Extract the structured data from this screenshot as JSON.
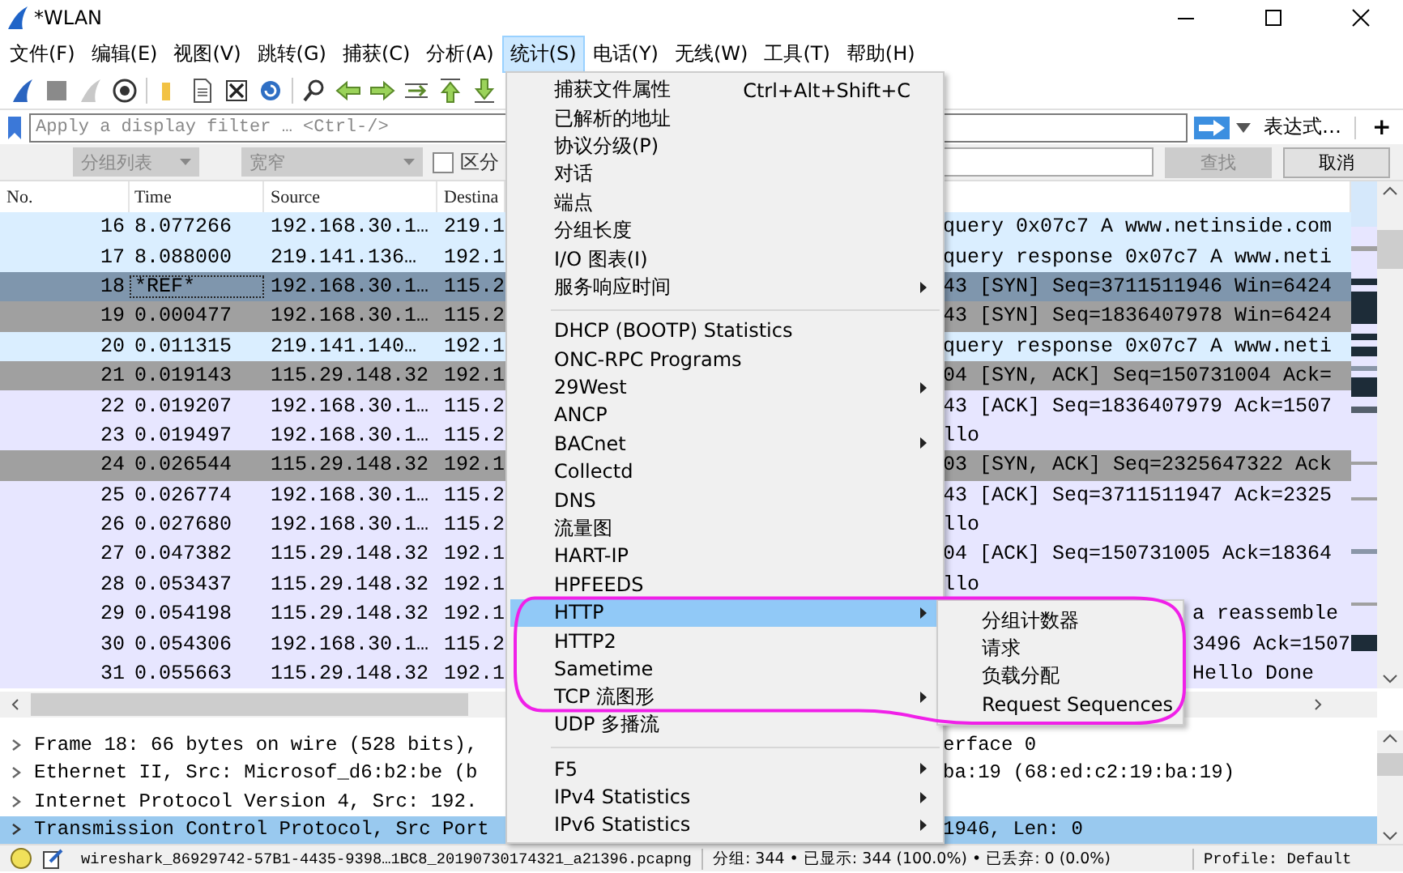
{
  "window": {
    "title": "*WLAN"
  },
  "menubar": [
    {
      "label": "文件(F)",
      "selected": false
    },
    {
      "label": "编辑(E)",
      "selected": false
    },
    {
      "label": "视图(V)",
      "selected": false
    },
    {
      "label": "跳转(G)",
      "selected": false
    },
    {
      "label": "捕获(C)",
      "selected": false
    },
    {
      "label": "分析(A)",
      "selected": false
    },
    {
      "label": "统计(S)",
      "selected": true
    },
    {
      "label": "电话(Y)",
      "selected": false
    },
    {
      "label": "无线(W)",
      "selected": false
    },
    {
      "label": "工具(T)",
      "selected": false
    },
    {
      "label": "帮助(H)",
      "selected": false
    }
  ],
  "display_filter": {
    "placeholder": "Apply a display filter … <Ctrl-/>",
    "expression_button": "表达式…",
    "add_button": "+"
  },
  "find_bar": {
    "scope": {
      "value": "分组列表",
      "disabled": true
    },
    "charset": {
      "value": "宽窄",
      "disabled": true
    },
    "case_checkbox": {
      "label": "区分",
      "checked": false
    },
    "find_button": {
      "label": "查找",
      "disabled": true
    },
    "cancel_button": {
      "label": "取消",
      "disabled": false
    }
  },
  "packet_list": {
    "columns": [
      "No.",
      "Time",
      "Source",
      "Destina"
    ],
    "rows": [
      {
        "no": "16",
        "time": "8.077266",
        "source": "192.168.30.1…",
        "destination": "219.1",
        "info": "query 0x07c7 A www.netinside.com",
        "color": "#daeeff",
        "selected": false,
        "info_covered": false
      },
      {
        "no": "17",
        "time": "8.088000",
        "source": "219.141.136…",
        "destination": "192.1",
        "info": "query response 0x07c7 A www.neti",
        "color": "#daeeff",
        "selected": false,
        "info_covered": false
      },
      {
        "no": "18",
        "time": "*REF*",
        "source": "192.168.30.1…",
        "destination": "115.2",
        "info": "43 [SYN] Seq=3711511946 Win=6424",
        "selected": true,
        "info_covered": false
      },
      {
        "no": "19",
        "time": "0.000477",
        "source": "192.168.30.1…",
        "destination": "115.2",
        "info": "43 [SYN] Seq=1836407978 Win=6424",
        "color": "#a0a0a0",
        "selected": false,
        "info_covered": false
      },
      {
        "no": "20",
        "time": "0.011315",
        "source": "219.141.140…",
        "destination": "192.1",
        "info": "query response 0x07c7 A www.neti",
        "color": "#daeeff",
        "selected": false,
        "info_covered": false
      },
      {
        "no": "21",
        "time": "0.019143",
        "source": "115.29.148.32",
        "destination": "192.1",
        "info": "04 [SYN, ACK] Seq=150731004 Ack=",
        "color": "#a0a0a0",
        "selected": false,
        "info_covered": false
      },
      {
        "no": "22",
        "time": "0.019207",
        "source": "192.168.30.1…",
        "destination": "115.2",
        "info": "43 [ACK] Seq=1836407979 Ack=1507",
        "color": "#e7e6ff",
        "selected": false,
        "info_covered": false
      },
      {
        "no": "23",
        "time": "0.019497",
        "source": "192.168.30.1…",
        "destination": "115.2",
        "info": "llo",
        "color": "#e7e6ff",
        "selected": false,
        "info_covered": false
      },
      {
        "no": "24",
        "time": "0.026544",
        "source": "115.29.148.32",
        "destination": "192.1",
        "info": "03 [SYN, ACK] Seq=2325647322 Ack",
        "color": "#a0a0a0",
        "selected": false,
        "info_covered": false
      },
      {
        "no": "25",
        "time": "0.026774",
        "source": "192.168.30.1…",
        "destination": "115.2",
        "info": "43 [ACK] Seq=3711511947 Ack=2325",
        "color": "#e7e6ff",
        "selected": false,
        "info_covered": false
      },
      {
        "no": "26",
        "time": "0.027680",
        "source": "192.168.30.1…",
        "destination": "115.2",
        "info": "llo",
        "color": "#e7e6ff",
        "selected": false,
        "info_covered": false
      },
      {
        "no": "27",
        "time": "0.047382",
        "source": "115.29.148.32",
        "destination": "192.1",
        "info": "04 [ACK] Seq=150731005 Ack=18364",
        "color": "#e7e6ff",
        "selected": false,
        "info_covered": false
      },
      {
        "no": "28",
        "time": "0.053437",
        "source": "115.29.148.32",
        "destination": "192.1",
        "info": "llo",
        "color": "#e7e6ff",
        "selected": false,
        "info_covered": false
      },
      {
        "no": "29",
        "time": "0.054198",
        "source": "115.29.148.32",
        "destination": "192.1",
        "info": "a reassemble",
        "color": "#e7e6ff",
        "selected": false,
        "info_covered": true
      },
      {
        "no": "30",
        "time": "0.054306",
        "source": "192.168.30.1…",
        "destination": "115.2",
        "info": "3496 Ack=1507",
        "color": "#e7e6ff",
        "selected": false,
        "info_covered": true
      },
      {
        "no": "31",
        "time": "0.055663",
        "source": "115.29.148.32",
        "destination": "192.1",
        "info": "Hello Done",
        "color": "#e7e6ff",
        "selected": false,
        "info_covered": true
      }
    ]
  },
  "details": [
    {
      "left": "Frame 18: 66 bytes on wire (528 bits),",
      "right": "erface 0",
      "expanded": false,
      "selected": false
    },
    {
      "left": "Ethernet II, Src: Microsof_d6:b2:be (b",
      "right": "ba:19 (68:ed:c2:19:ba:19)",
      "expanded": false,
      "selected": false
    },
    {
      "left": "Internet Protocol Version 4, Src: 192.",
      "expanded": false,
      "selected": false
    },
    {
      "left": "Transmission Control Protocol, Src Port",
      "right": "1946, Len: 0",
      "expanded": false,
      "selected": true
    }
  ],
  "status_bar": {
    "file": "wireshark_86929742-57B1-4435-9398…1BC8_20190730174321_a21396.pcapng",
    "counts": "分组: 344 • 已显示: 344 (100.0%) • 已丢弃: 0 (0.0%)",
    "profile": "Profile: Default"
  },
  "statistics_menu": [
    {
      "kind": "item",
      "label": "捕获文件属性",
      "shortcut": "Ctrl+Alt+Shift+C",
      "submenu": false,
      "selected": false
    },
    {
      "kind": "item",
      "label": "已解析的地址",
      "submenu": false,
      "selected": false
    },
    {
      "kind": "item",
      "label": "协议分级(P)",
      "submenu": false,
      "selected": false
    },
    {
      "kind": "item",
      "label": "对话",
      "submenu": false,
      "selected": false
    },
    {
      "kind": "item",
      "label": "端点",
      "submenu": false,
      "selected": false
    },
    {
      "kind": "item",
      "label": "分组长度",
      "submenu": false,
      "selected": false
    },
    {
      "kind": "item",
      "label": "I/O 图表(I)",
      "submenu": false,
      "selected": false
    },
    {
      "kind": "item",
      "label": "服务响应时间",
      "submenu": true,
      "selected": false
    },
    {
      "kind": "separator"
    },
    {
      "kind": "item",
      "label": "DHCP (BOOTP) Statistics",
      "submenu": false,
      "selected": false
    },
    {
      "kind": "item",
      "label": "ONC-RPC Programs",
      "submenu": false,
      "selected": false
    },
    {
      "kind": "item",
      "label": "29West",
      "submenu": true,
      "selected": false
    },
    {
      "kind": "item",
      "label": "ANCP",
      "submenu": false,
      "selected": false
    },
    {
      "kind": "item",
      "label": "BACnet",
      "submenu": true,
      "selected": false
    },
    {
      "kind": "item",
      "label": "Collectd",
      "submenu": false,
      "selected": false
    },
    {
      "kind": "item",
      "label": "DNS",
      "submenu": false,
      "selected": false
    },
    {
      "kind": "item",
      "label": "流量图",
      "submenu": false,
      "selected": false
    },
    {
      "kind": "item",
      "label": "HART-IP",
      "submenu": false,
      "selected": false
    },
    {
      "kind": "item",
      "label": "HPFEEDS",
      "submenu": false,
      "selected": false
    },
    {
      "kind": "item",
      "label": "HTTP",
      "submenu": true,
      "selected": true
    },
    {
      "kind": "item",
      "label": "HTTP2",
      "submenu": false,
      "selected": false
    },
    {
      "kind": "item",
      "label": "Sametime",
      "submenu": false,
      "selected": false
    },
    {
      "kind": "item",
      "label": "TCP 流图形",
      "submenu": true,
      "selected": false
    },
    {
      "kind": "item",
      "label": "UDP 多播流",
      "submenu": false,
      "selected": false
    },
    {
      "kind": "separator"
    },
    {
      "kind": "item",
      "label": "F5",
      "submenu": true,
      "selected": false
    },
    {
      "kind": "item",
      "label": "IPv4 Statistics",
      "submenu": true,
      "selected": false
    },
    {
      "kind": "item",
      "label": "IPv6 Statistics",
      "submenu": true,
      "selected": false
    }
  ],
  "http_submenu": [
    {
      "label": "分组计数器"
    },
    {
      "label": "请求"
    },
    {
      "label": "负载分配"
    },
    {
      "label": "Request Sequences"
    }
  ]
}
